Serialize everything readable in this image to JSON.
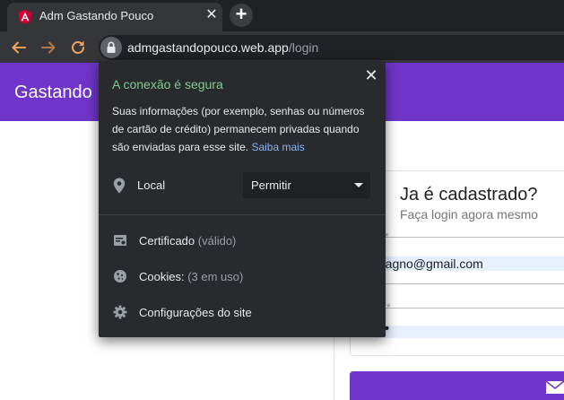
{
  "browser": {
    "tab": {
      "title": "Adm Gastando Pouco",
      "close_glyph": "✕",
      "favicon_icon": "angular-icon",
      "favicon_color": "#dd0031"
    },
    "new_tab_glyph": "+",
    "nav": {
      "back_icon": "arrow-left-icon",
      "forward_icon": "arrow-right-icon",
      "reload_icon": "reload-icon",
      "icon_color": "#f0a35a"
    },
    "omnibox": {
      "lock_icon": "lock-icon",
      "url_host": "admgastandopouco.web.app",
      "url_path": "/login"
    }
  },
  "page": {
    "app_title": "Gastando",
    "accent_color": "#6f35c8",
    "login_card": {
      "title": "Ja é cadastrado?",
      "subtitle": "Faça login agora mesmo",
      "email_label": "*",
      "email_value": "magno@gmail.com",
      "password_label": "a *",
      "password_value": "••",
      "submit_icon": "mail-icon"
    }
  },
  "popup": {
    "close_glyph": "✕",
    "title": "A conexão é segura",
    "title_color": "#81c995",
    "description": "Suas informações (por exemplo, senhas ou números de cartão de crédito) permanecem privadas quando são enviadas para esse site.",
    "learn_more": "Saiba mais",
    "permission": {
      "icon": "location-pin-icon",
      "label": "Local",
      "selected": "Permitir"
    },
    "rows": {
      "certificate": {
        "icon": "certificate-icon",
        "label": "Certificado",
        "detail": "(válido)"
      },
      "cookies": {
        "icon": "cookie-icon",
        "label": "Cookies:",
        "detail": "(3 em uso)"
      },
      "site_settings": {
        "icon": "gear-icon",
        "label": "Configurações do site"
      }
    }
  }
}
